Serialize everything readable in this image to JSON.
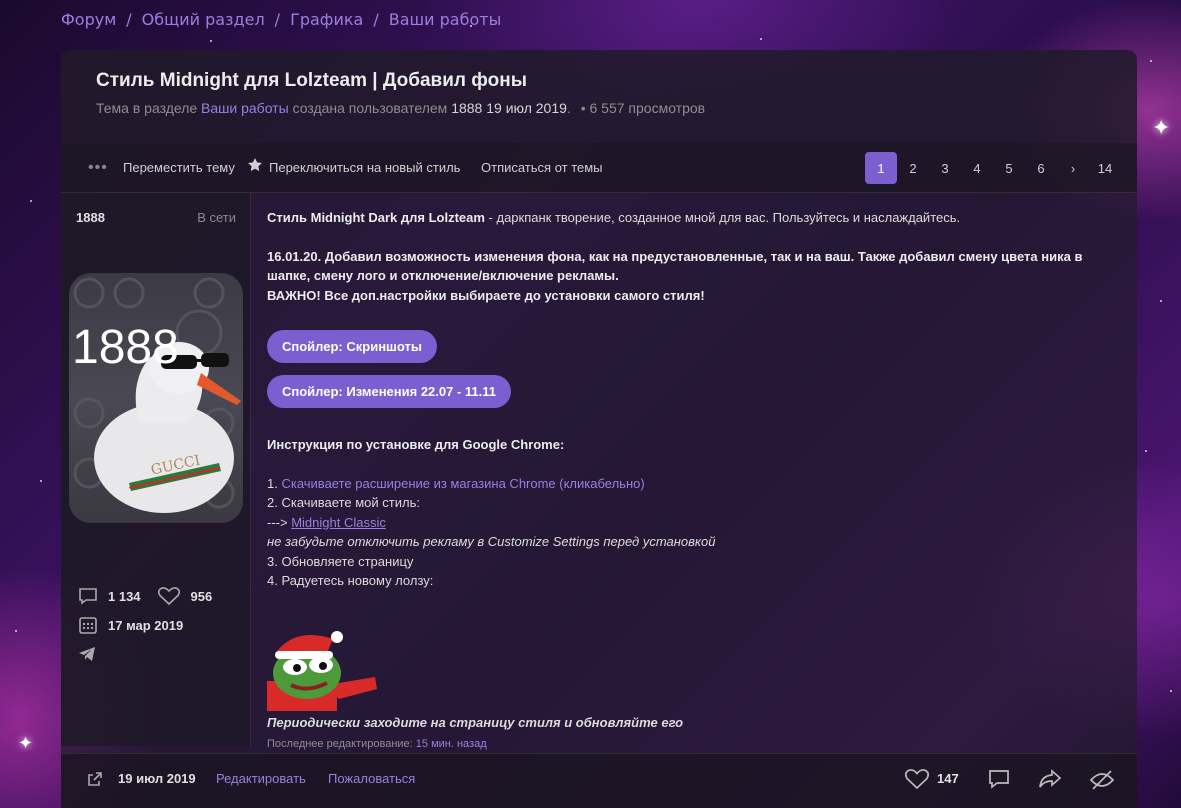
{
  "breadcrumb": [
    "Форум",
    "Общий раздел",
    "Графика",
    "Ваши работы"
  ],
  "thread": {
    "title": "Стиль Midnight для Lolzteam | Добавил фоны",
    "meta_prefix": "Тема в разделе",
    "meta_section": "Ваши работы",
    "meta_created": "создана пользователем",
    "meta_author": "1888",
    "meta_date": "19 июл 2019",
    "meta_views": "• 6 557 просмотров"
  },
  "toolbar": {
    "move": "Переместить тему",
    "new_style": "Переключиться на новый стиль",
    "unsubscribe": "Отписаться от темы",
    "pages": [
      "1",
      "2",
      "3",
      "4",
      "5",
      "6",
      "›",
      "14"
    ],
    "active_page": "1"
  },
  "user": {
    "name": "1888",
    "status": "В сети",
    "avatar_text": "1888",
    "avatar_brand": "GUCCI",
    "messages": "1 134",
    "likes": "956",
    "registered": "17 мар 2019"
  },
  "post": {
    "intro_bold": "Стиль Midnight Dark для Lolzteam",
    "intro_rest": " - даркпанк творение, созданное мной для вас. Пользуйтесь и наслаждайтесь.",
    "update_line1": "16.01.20. Добавил возможность изменения фона, как на предустановленные, так и на ваш. Также добавил смену цвета ника в",
    "update_line2": "шапке, смену лого и отключение/включение рекламы.",
    "important": "ВАЖНО! Все доп.настройки выбираете до установки самого стиля!",
    "spoiler1": "Спойлер: Скриншоты",
    "spoiler2": "Спойлер: Изменения 22.07 - 11.11",
    "instr_title": "Инструкция по установке для Google Chrome:",
    "step1_num": "1. ",
    "step1_link": "Скачиваете расширение из магазина Chrome (кликабельно)",
    "step2": "2. Скачиваете мой стиль:",
    "step2_arrow": "---> ",
    "step2_link": "Midnight Classic",
    "step2_note": "не забудьте отключить рекламу в Customize Settings перед установкой",
    "step3": "3. Обновляете страницу",
    "step4": "4. Радуетесь новому лолзу:",
    "footer_note": "Периодически заходите на страницу стиля и обновляйте его",
    "edit_label": "Последнее редактирование: ",
    "edit_time": "15 мин. назад"
  },
  "footer": {
    "date": "19 июл 2019",
    "edit": "Редактировать",
    "report": "Пожаловаться",
    "likes": "147"
  },
  "colors": {
    "accent": "#7b5fd0",
    "link": "#9b7fe0"
  }
}
